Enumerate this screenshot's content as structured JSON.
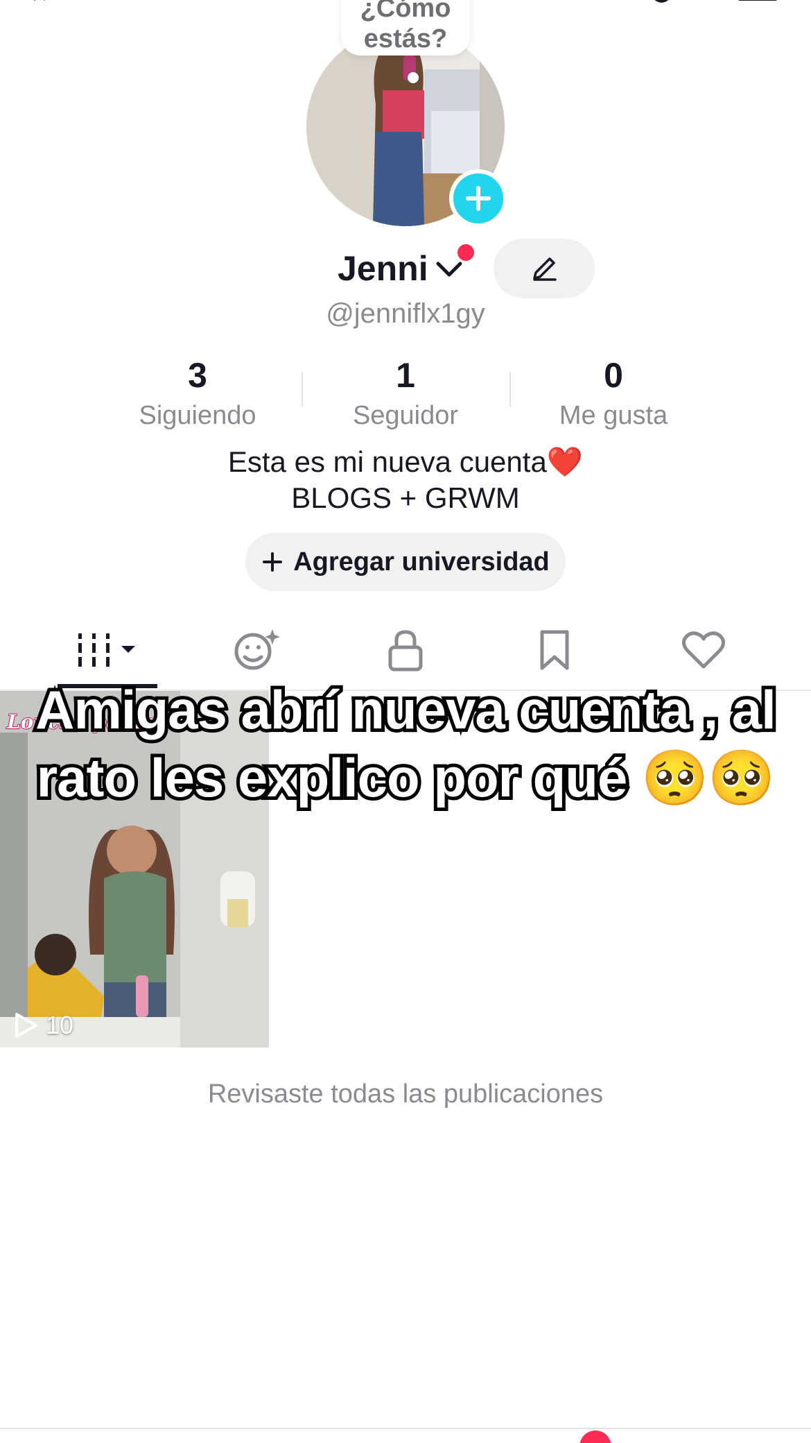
{
  "note": {
    "text": "¿Cómo\nestás?"
  },
  "profile": {
    "display_name": "Jenni",
    "username": "@jenniflx1gy",
    "bio_line1": "Esta es mi nueva cuenta",
    "bio_heart": "❤️",
    "bio_line2": "BLOGS + GRWM",
    "add_university_label": "Agregar universidad"
  },
  "stats": [
    {
      "value": "3",
      "label": "Siguiendo"
    },
    {
      "value": "1",
      "label": "Seguidor"
    },
    {
      "value": "0",
      "label": "Me gusta"
    }
  ],
  "tabs": [
    {
      "icon": "videos-grid-icon",
      "active": true
    },
    {
      "icon": "reposts-icon",
      "active": false
    },
    {
      "icon": "lock-icon",
      "active": false
    },
    {
      "icon": "bookmark-icon",
      "active": false
    },
    {
      "icon": "heart-icon",
      "active": false
    }
  ],
  "videos": [
    {
      "caption": "Lonche para pre",
      "views": "10"
    }
  ],
  "overlay": {
    "text": "Amigas abrí nueva cuenta , al rato les explico por qué 🥺🥺"
  },
  "end_text": "Revisaste todas las publicaciones",
  "colors": {
    "accent_cyan": "#20d5ec",
    "accent_red": "#fe2c55",
    "text_primary": "#161823",
    "text_secondary": "#8a8b91",
    "chip_bg": "#f1f1f2"
  }
}
